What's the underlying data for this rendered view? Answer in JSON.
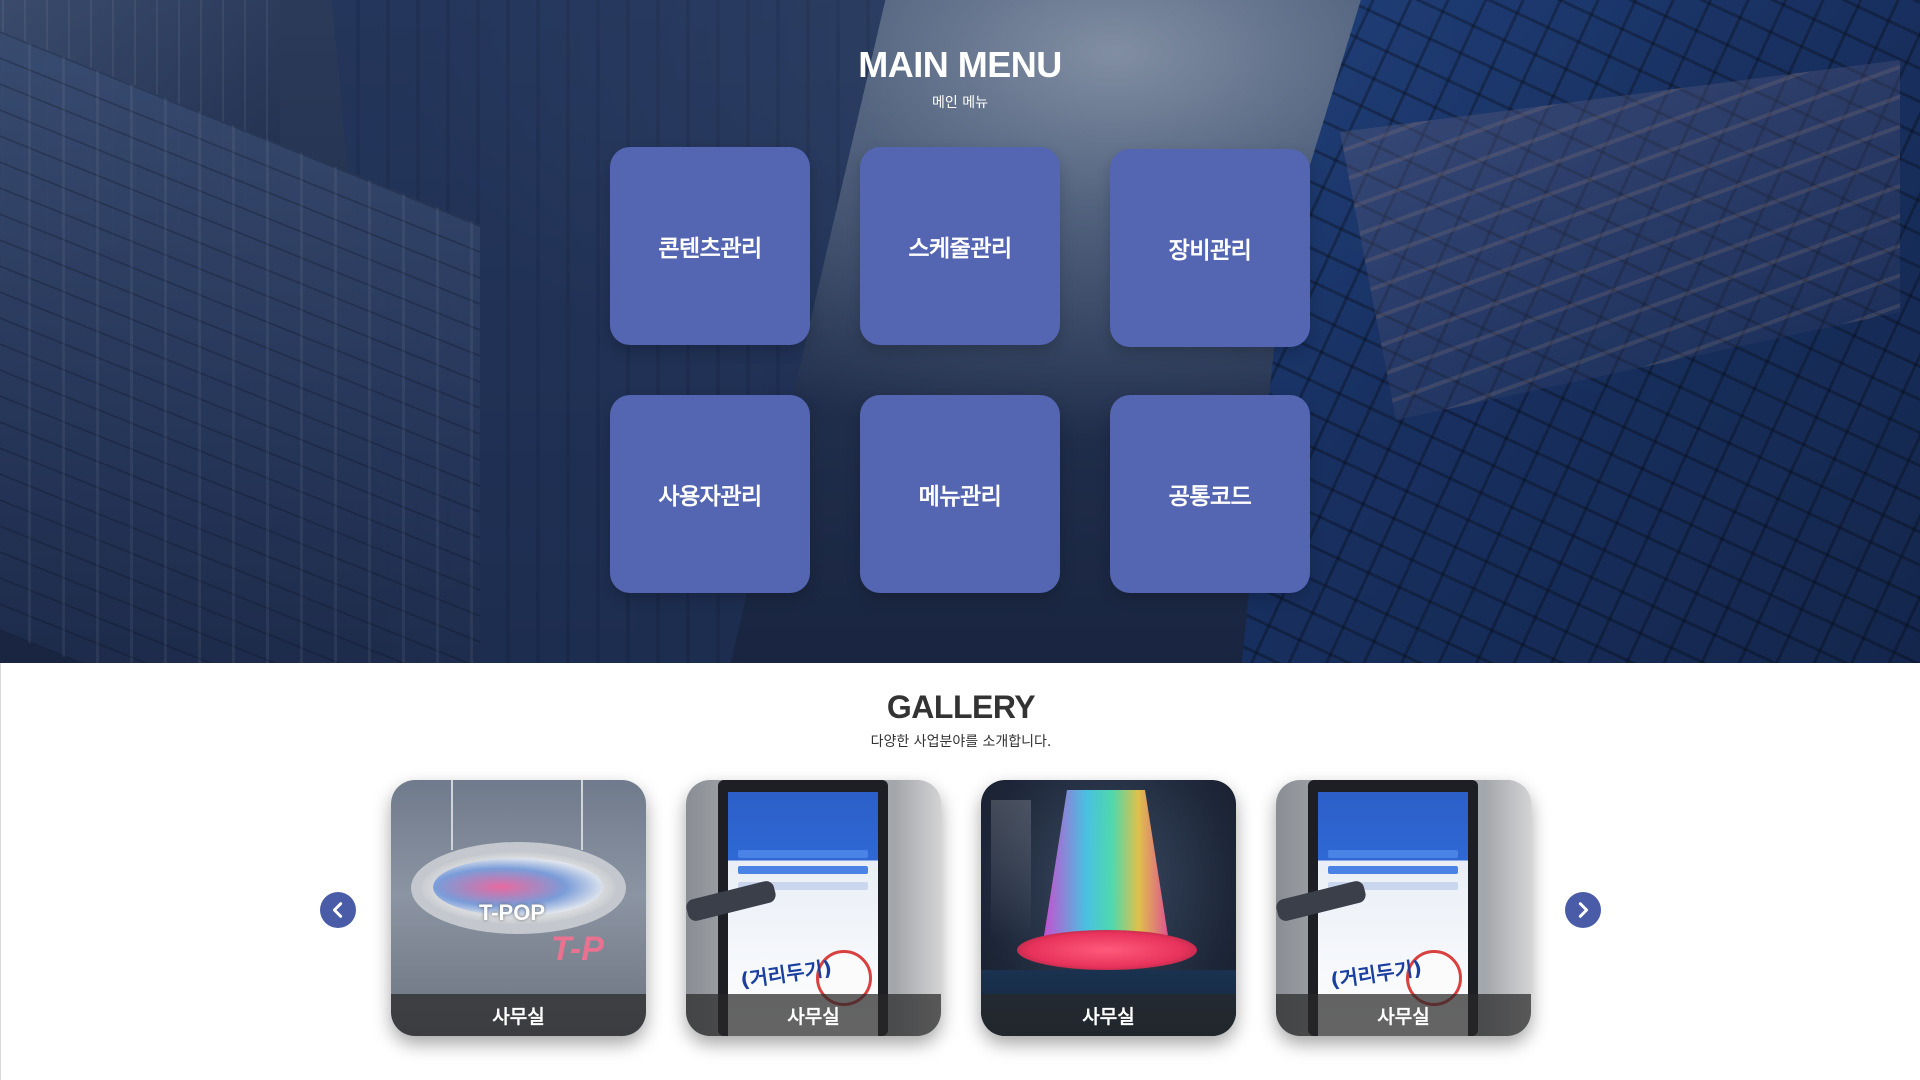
{
  "main_menu": {
    "title": "MAIN MENU",
    "subtitle": "메인 메뉴",
    "items": [
      {
        "label": "콘텐츠관리"
      },
      {
        "label": "스케줄관리"
      },
      {
        "label": "장비관리"
      },
      {
        "label": "사용자관리"
      },
      {
        "label": "메뉴관리"
      },
      {
        "label": "공통코드"
      }
    ],
    "card_color": "#5465b1"
  },
  "gallery": {
    "title": "GALLERY",
    "subtitle": "다양한 사업분야를 소개합니다.",
    "items": [
      {
        "caption": "사무실",
        "image": "led-ring-display",
        "overlay_text": "T-POP",
        "wall_text": "T-P"
      },
      {
        "caption": "사무실",
        "image": "kiosk-screen",
        "overlay_text": "(거리두기)"
      },
      {
        "caption": "사무실",
        "image": "led-column-display"
      },
      {
        "caption": "사무실",
        "image": "kiosk-screen",
        "overlay_text": "(거리두기)"
      }
    ],
    "prev_icon": "chevron-left-icon",
    "next_icon": "chevron-right-icon",
    "arrow_color": "#4a5ca8"
  }
}
